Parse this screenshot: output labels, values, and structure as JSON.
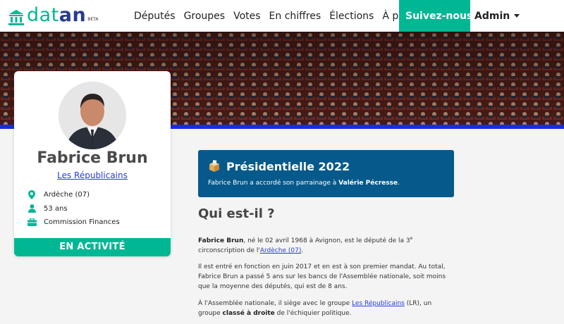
{
  "brand": {
    "part1": "dat",
    "part2": "an",
    "beta": "BETA"
  },
  "nav": {
    "items": [
      "Députés",
      "Groupes",
      "Votes",
      "En chiffres",
      "Élections",
      "À propos"
    ],
    "follow": "Suivez-nous",
    "admin": "Admin"
  },
  "colors": {
    "accent": "#00b794",
    "navy": "#263c8f",
    "stripe": "#1b2cdd",
    "pres_box": "#05598b",
    "link": "#263cdc"
  },
  "profile": {
    "name": "Fabrice Brun",
    "group": "Les Républicains",
    "location": "Ardèche (07)",
    "age": "53 ans",
    "commission": "Commission Finances",
    "status": "EN ACTIVITÉ",
    "icons": {
      "location": "map-marker-icon",
      "age": "person-icon",
      "commission": "briefcase-icon"
    }
  },
  "presidentielle": {
    "title": "Présidentielle 2022",
    "icon": "ballot-box-icon",
    "text_before": "Fabrice Brun a accordé son parrainage à ",
    "candidate": "Valérie Pécresse",
    "text_after": "."
  },
  "about": {
    "heading": "Qui est-il ?",
    "p1": {
      "name": "Fabrice Brun",
      "t1": ", né le 02 avril 1968 à Avignon, est le député de la 3",
      "sup": "e",
      "t2": " circonscription de l'",
      "link": "Ardèche (07)",
      "t3": "."
    },
    "p2": "Il est entré en fonction en juin 2017 et en est à son premier mandat. Au total, Fabrice Brun a passé 5 ans sur les bancs de l'Assemblée nationale, soit moins que la moyenne des députés, qui est de 8 ans.",
    "p3": {
      "t1": "À l'Assemblée nationale, il siège avec le groupe ",
      "link": "Les Républicains",
      "t2": " (LR), un groupe ",
      "bold": "classé à droite",
      "t3": " de l'échiquier politique."
    }
  }
}
